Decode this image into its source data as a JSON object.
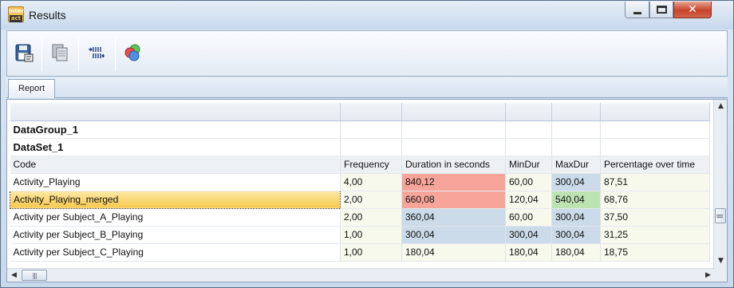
{
  "window": {
    "title": "Results",
    "app_icon_top": "inter",
    "app_icon_bottom": "act",
    "minimize_icon": "minimize-icon",
    "maximize_icon": "maximize-icon",
    "close_icon": "close-icon"
  },
  "toolbar": {
    "buttons": [
      {
        "name": "save",
        "icon": "save-icon"
      },
      {
        "name": "copy",
        "icon": "copy-icon"
      },
      {
        "name": "columns",
        "icon": "columns-icon"
      },
      {
        "name": "color",
        "icon": "color-circles-icon"
      }
    ]
  },
  "tabs": [
    {
      "label": "Report",
      "active": true
    }
  ],
  "grid": {
    "group_label": "DataGroup_1",
    "dataset_label": "DataSet_1",
    "columns": [
      "Code",
      "Frequency",
      "Duration in seconds",
      "MinDur",
      "MaxDur",
      "Percentage over time"
    ],
    "rows": [
      {
        "code": "Activity_Playing",
        "frequency": "4,00",
        "duration": "840,12",
        "mindur": "60,00",
        "maxdur": "300,04",
        "percentage": "87,51"
      },
      {
        "code": "Activity_Playing_merged",
        "frequency": "2,00",
        "duration": "660,08",
        "mindur": "120,04",
        "maxdur": "540,04",
        "percentage": "68,76"
      },
      {
        "code": "Activity per Subject_A_Playing",
        "frequency": "2,00",
        "duration": "360,04",
        "mindur": "60,00",
        "maxdur": "300,04",
        "percentage": "37,50"
      },
      {
        "code": "Activity per Subject_B_Playing",
        "frequency": "1,00",
        "duration": "300,04",
        "mindur": "300,04",
        "maxdur": "300,04",
        "percentage": "31,25"
      },
      {
        "code": "Activity per Subject_C_Playing",
        "frequency": "1,00",
        "duration": "180,04",
        "mindur": "180,04",
        "maxdur": "180,04",
        "percentage": "18,75"
      }
    ],
    "highlight_colors": {
      "high": "#f7a59a",
      "mid": "#cbdbe9",
      "max": "#bde3b2",
      "low": "#f7f9ec"
    }
  },
  "scrollbars": {
    "up_arrow": "▲",
    "down_arrow": "▼",
    "left_arrow": "◀",
    "right_arrow": "▶",
    "grip": "|||"
  }
}
